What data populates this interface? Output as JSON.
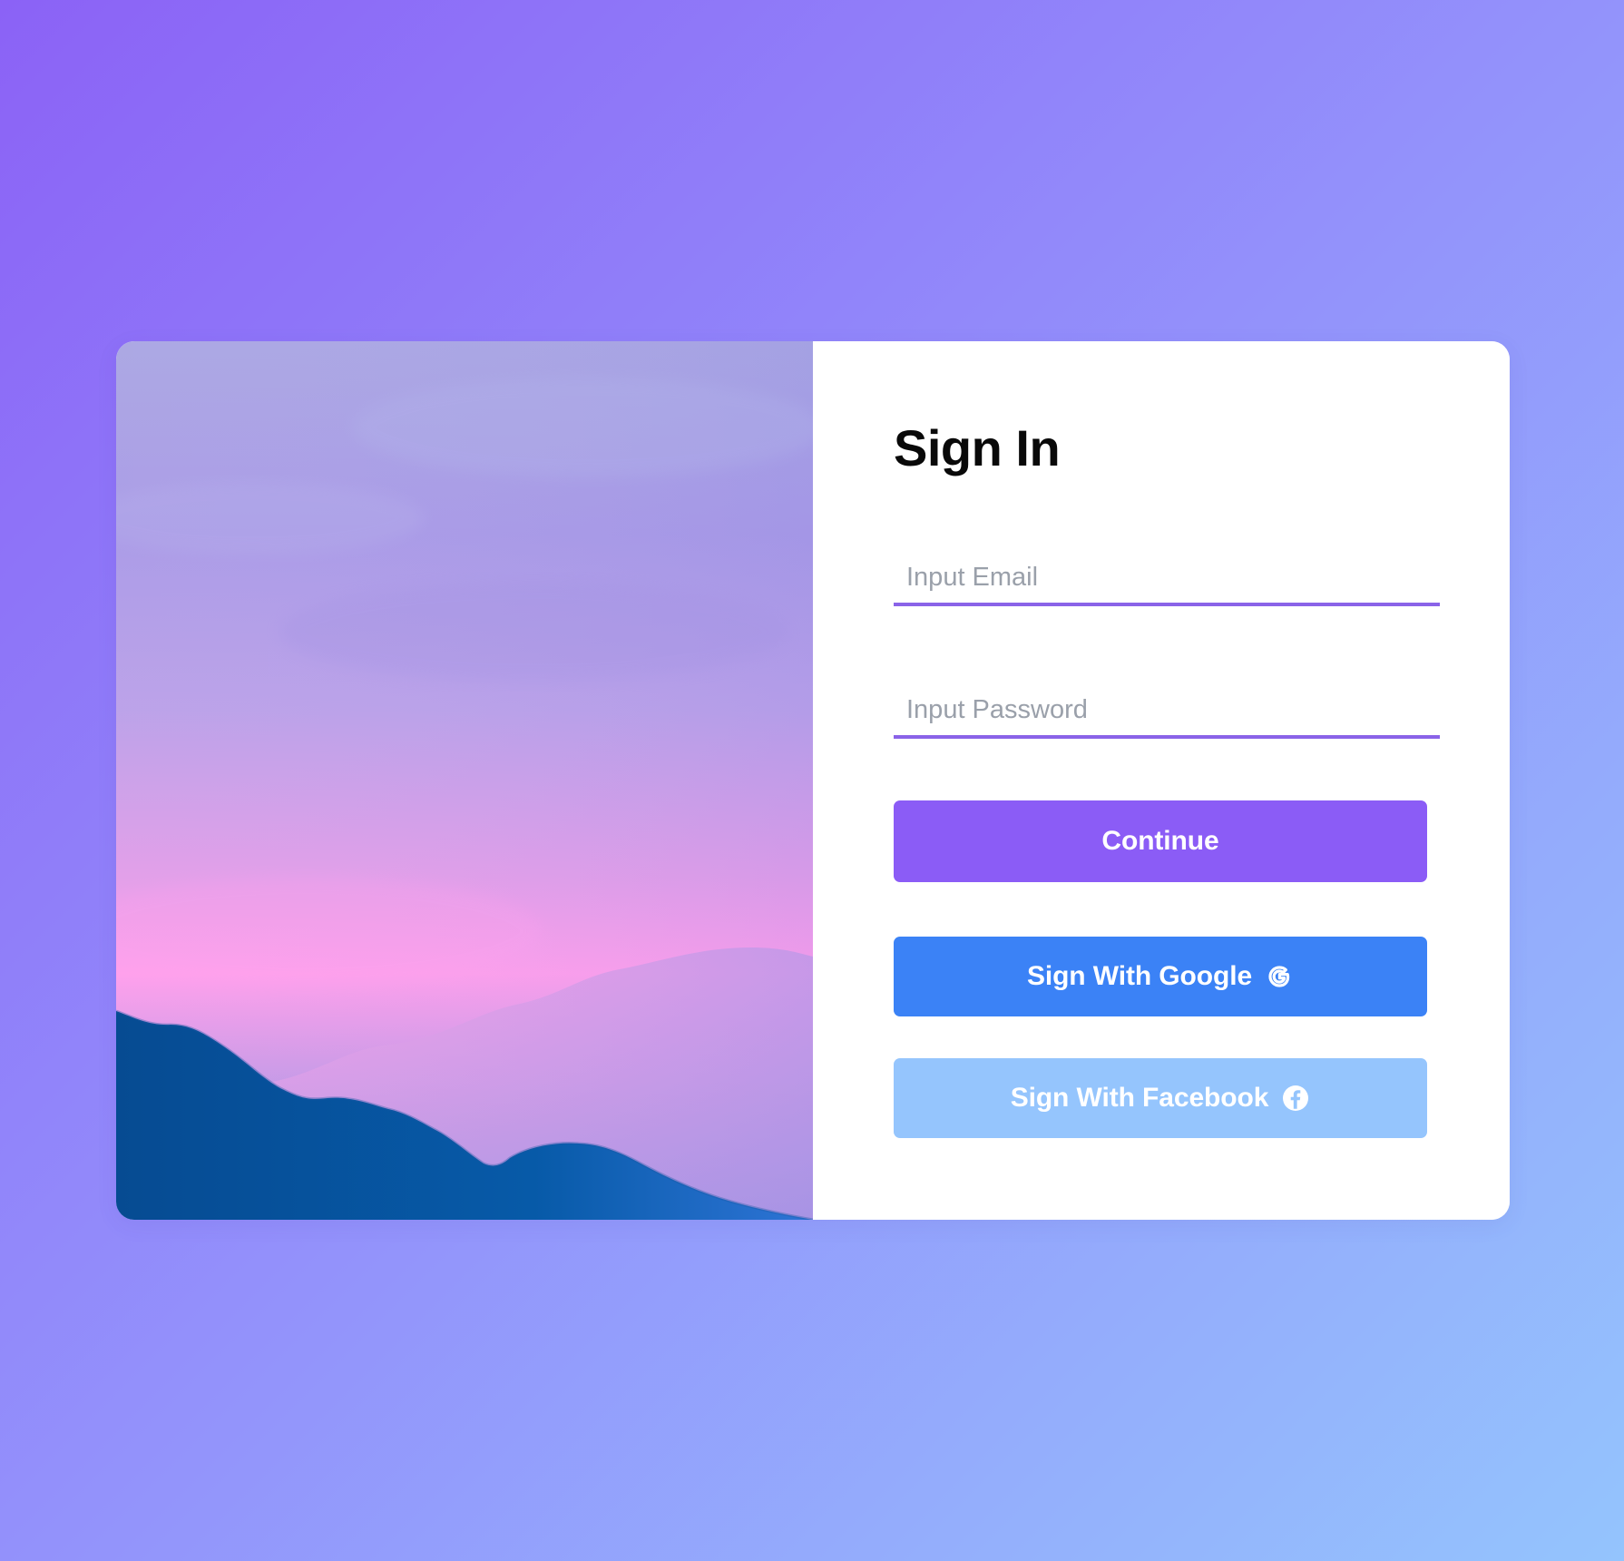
{
  "page": {
    "background_colors": [
      "#8b62f6",
      "#9390fb",
      "#94c4fd"
    ]
  },
  "hero": {
    "image_label": "mountain sunset landscape"
  },
  "signin": {
    "title": "Sign In",
    "email_placeholder": "Input Email",
    "email_value": "",
    "password_placeholder": "Input Password",
    "password_value": "",
    "continue_label": "Continue",
    "google_label": "Sign With Google",
    "google_icon": "google-icon",
    "facebook_label": "Sign With Facebook",
    "facebook_icon": "facebook-icon"
  },
  "colors": {
    "accent": "#8b5cf6",
    "google_button": "#3b82f6",
    "facebook_button": "#95c5fd",
    "input_underline": "#8a63e8"
  }
}
